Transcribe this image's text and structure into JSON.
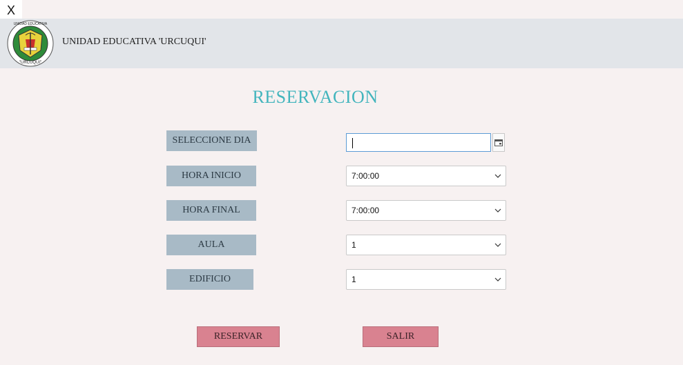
{
  "window": {
    "close_label": "X"
  },
  "header": {
    "school_name": "UNIDAD EDUCATIVA 'URCUQUI'",
    "logo_top_text": "UNIDAD EDUCATIVA",
    "logo_bottom_text": "\"URCUQUI\""
  },
  "form": {
    "title": "RESERVACION",
    "labels": {
      "day": "SELECCIONE DIA",
      "start": "HORA INICIO",
      "end": "HORA FINAL",
      "room": "AULA",
      "building": "EDIFICIO"
    },
    "fields": {
      "day_value": "",
      "start_value": "7:00:00",
      "end_value": "7:00:00",
      "room_value": "1",
      "building_value": "1"
    },
    "buttons": {
      "reserve": "RESERVAR",
      "exit": "SALIR"
    }
  },
  "colors": {
    "title": "#43b5bd",
    "label_bg": "#a8bac6",
    "button_bg": "#d98290",
    "header_bg": "#e2e5e9"
  },
  "icons": [
    "close-icon",
    "school-logo",
    "calendar-icon",
    "chevron-down-icon"
  ]
}
